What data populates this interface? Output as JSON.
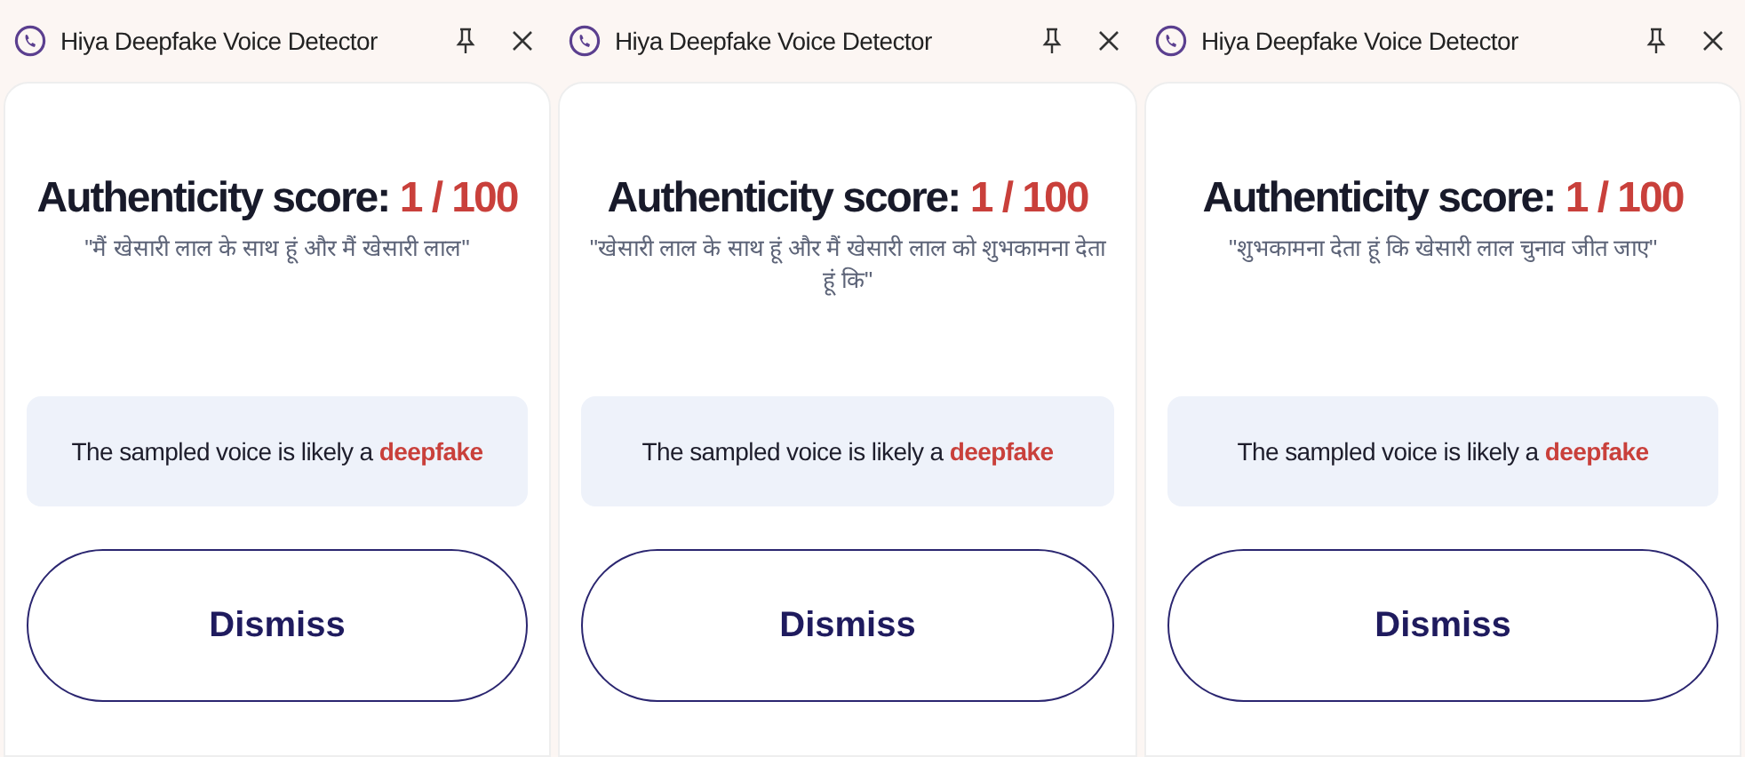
{
  "panels": [
    {
      "title": "Hiya Deepfake Voice Detector",
      "score_label": "Authenticity score:",
      "score": "1 / 100",
      "quote": "\"मैं खेसारी लाल के साथ हूं और मैं खेसारी लाल\"",
      "verdict": "The sampled voice is likely a",
      "verdict_label": "deepfake",
      "button": "Dismiss"
    },
    {
      "title": "Hiya Deepfake Voice Detector",
      "score_label": "Authenticity score:",
      "score": "1 / 100",
      "quote": "\"खेसारी लाल के साथ हूं और मैं खेसारी लाल को शुभकामना देता हूं कि\"",
      "verdict": "The sampled voice is likely a",
      "verdict_label": "deepfake",
      "button": "Dismiss"
    },
    {
      "title": "Hiya Deepfake Voice Detector",
      "score_label": "Authenticity score:",
      "score": "1 / 100",
      "quote": "\"शुभकामना देता हूं कि खेसारी लाल चुनाव जीत जाए\"",
      "verdict": "The sampled voice is likely a",
      "verdict_label": "deepfake",
      "button": "Dismiss"
    }
  ]
}
